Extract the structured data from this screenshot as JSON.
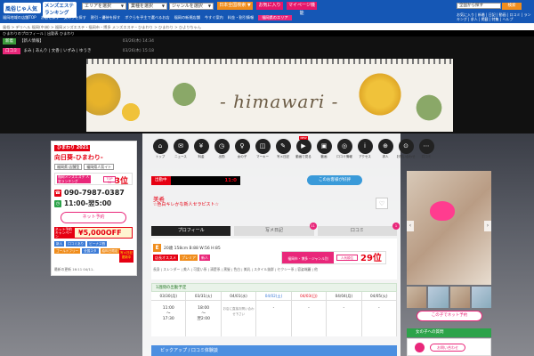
{
  "header": {
    "logo": "風俗じゃ人気",
    "mens_label": "メンズエステ\nランキング",
    "area_select": "エリアを選択",
    "industry_select": "業種を選択",
    "genre_select": "ジャンルを選択",
    "btn_free_search": "日本全国検索 ▼",
    "btn_bookmark": "お気に入り",
    "btn_mypage": "マイページ機能",
    "site_select": "全国から探す",
    "search_btn": "検索",
    "toplinks": "お気に入り | 新着 | 日記 | 動画 | 口コミ | ランキング | 求人 | 掲載 | 特集 | ヘルプ",
    "nav": [
      "福岡地域の店舗TOP",
      "お店を探す",
      "女の子を探す",
      "割引・優待を探す",
      "ボクらを乎主で選べるお店",
      "福岡の新規店舗",
      "今すぐ案内",
      "料金・割引情報",
      "福岡県のエリア"
    ],
    "nav_highlight": "福岡県のエリア"
  },
  "breadcrumb": "風俗 > デリヘル 福岡(中洲) > 福岡メンズエステ・福岡市・博多 メンズエステ・ひまわり > ひまわり > ひよりちゃん",
  "subhead": "ひまわりのプロフィール | 出勤表 ひまわり",
  "notices": [
    {
      "tag": "新着",
      "text": "【新人情報】 ",
      "time": "03/26(木) 14:34",
      "green": true
    },
    {
      "tag": "口コミ",
      "text": "まみ | あんり | 文香 | いずみ | ゆうき",
      "time": "03/26(木) 15:18",
      "green": false
    }
  ],
  "hero": {
    "title": "- himawari -"
  },
  "shop": {
    "badge": "ひまわり 2021",
    "name": "向日葵-ひまわり-",
    "tags": [
      "福岡県 店舗型",
      "福岡県人気イト"
    ],
    "rank_label": "福岡メンズエステ 人気ランキング",
    "rank_crown": "TOP 30",
    "rank_num": "3位",
    "tel": "090-7987-0387",
    "hours": "11:00-翌5:00",
    "net_btn": "ネット予約",
    "price_label": "ネット予約 キャンペーン",
    "price": "¥5,000OFF",
    "small_tags": [
      "新人",
      "口コミあり",
      "ビーナス割",
      "ゴールドフリー",
      "全国スタ",
      "給料日限定"
    ],
    "kiss": "写メ日記 更新中",
    "foot": "最新の更新 16:11 04/11-"
  },
  "icons": [
    {
      "label": "トップ",
      "glyph": "⌂"
    },
    {
      "label": "ニュース",
      "glyph": "✉"
    },
    {
      "label": "料金",
      "glyph": "¥"
    },
    {
      "label": "出勤",
      "glyph": "◷"
    },
    {
      "label": "女の子",
      "glyph": "♀"
    },
    {
      "label": "マーキー",
      "glyph": "◫"
    },
    {
      "label": "写メ日記",
      "glyph": "✎"
    },
    {
      "label": "動画で見る",
      "glyph": "▶",
      "new": "NEW"
    },
    {
      "label": "動画",
      "glyph": "▣"
    },
    {
      "label": "口コミ情報",
      "glyph": "◎"
    },
    {
      "label": "アクセス",
      "glyph": "i"
    },
    {
      "label": "求人",
      "glyph": "⊕"
    },
    {
      "label": "お問い合わせ",
      "glyph": "⊙"
    },
    {
      "label": "口コミ",
      "glyph": "⋯"
    }
  ],
  "status": {
    "label": "出勤中",
    "time": "11:0"
  },
  "chat_btn": "このお客様が好評",
  "girl": {
    "name": "美希",
    "sub": "☆色白キレかな新人セラピスト☆"
  },
  "tabs": [
    {
      "label": "プロフィール",
      "count": ""
    },
    {
      "label": "写メ日記",
      "count": "11"
    },
    {
      "label": "口コミ",
      "count": "1"
    }
  ],
  "profile": {
    "age": "20歳 158cm B:88 W:56 H:85",
    "badges": [
      "店長オススメ",
      "プレミア",
      "新人"
    ],
    "tags_line": "長身 | スレンダー | 美人 | 可愛い系 | 清楚系 | 黒髪 | 色白 | 美乳 | スタイル抜群 | セクシー系 | 容姿端麗 | 他",
    "rank_label": "福岡市・博多・ジャンル別",
    "rank_crown": "人気順位",
    "rank_num": "29位"
  },
  "schedule": {
    "header": "1週間の出勤予定",
    "days": [
      {
        "d": "03/30(月)",
        "v": "11:00\n〜\n17:30",
        "cls": ""
      },
      {
        "d": "03/31(火)",
        "v": "18:00\n〜\n翌2:00",
        "cls": ""
      },
      {
        "d": "04/01(水)",
        "v": "お店に直接お問い合わせ下さい",
        "cls": "small"
      },
      {
        "d": "04/02(土)",
        "v": "-",
        "cls": "sat"
      },
      {
        "d": "04/03(日)",
        "v": "-",
        "cls": "sun"
      },
      {
        "d": "04/04(月)",
        "v": "-",
        "cls": ""
      },
      {
        "d": "04/05(火)",
        "v": "-",
        "cls": ""
      }
    ]
  },
  "pickup": "ピックアップ / 口コミ体験談",
  "right": {
    "rsv": "この子でネット予約",
    "head": "女の子への質問",
    "pill": "お問い合わせ"
  },
  "colors": {
    "brand": "#1557b5",
    "accent": "#e9277a",
    "red": "#e60012",
    "green": "#2ca34a"
  }
}
